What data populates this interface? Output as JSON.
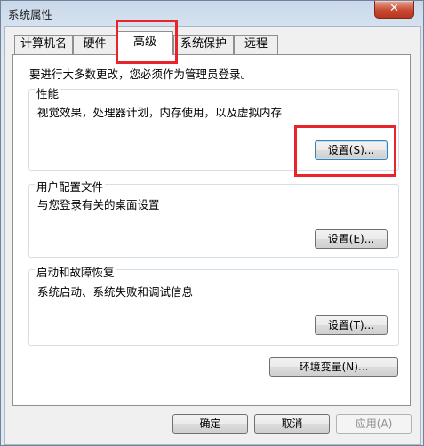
{
  "window": {
    "title": "系统属性",
    "close_glyph": "✕"
  },
  "tabs": [
    {
      "label": "计算机名"
    },
    {
      "label": "硬件"
    },
    {
      "label": "高级"
    },
    {
      "label": "系统保护"
    },
    {
      "label": "远程"
    }
  ],
  "active_tab": "高级",
  "notice": "要进行大多数更改，您必须作为管理员登录。",
  "groups": {
    "performance": {
      "title": "性能",
      "description": "视觉效果，处理器计划，内存使用，以及虚拟内存",
      "button": "设置(S)..."
    },
    "user_profiles": {
      "title": "用户配置文件",
      "description": "与您登录有关的桌面设置",
      "button": "设置(E)..."
    },
    "startup_recovery": {
      "title": "启动和故障恢复",
      "description": "系统启动、系统失败和调试信息",
      "button": "设置(T)..."
    }
  },
  "env_button": "环境变量(N)...",
  "footer": {
    "ok": "确定",
    "cancel": "取消",
    "apply": "应用(A)"
  },
  "highlight_color": "#e8252a"
}
